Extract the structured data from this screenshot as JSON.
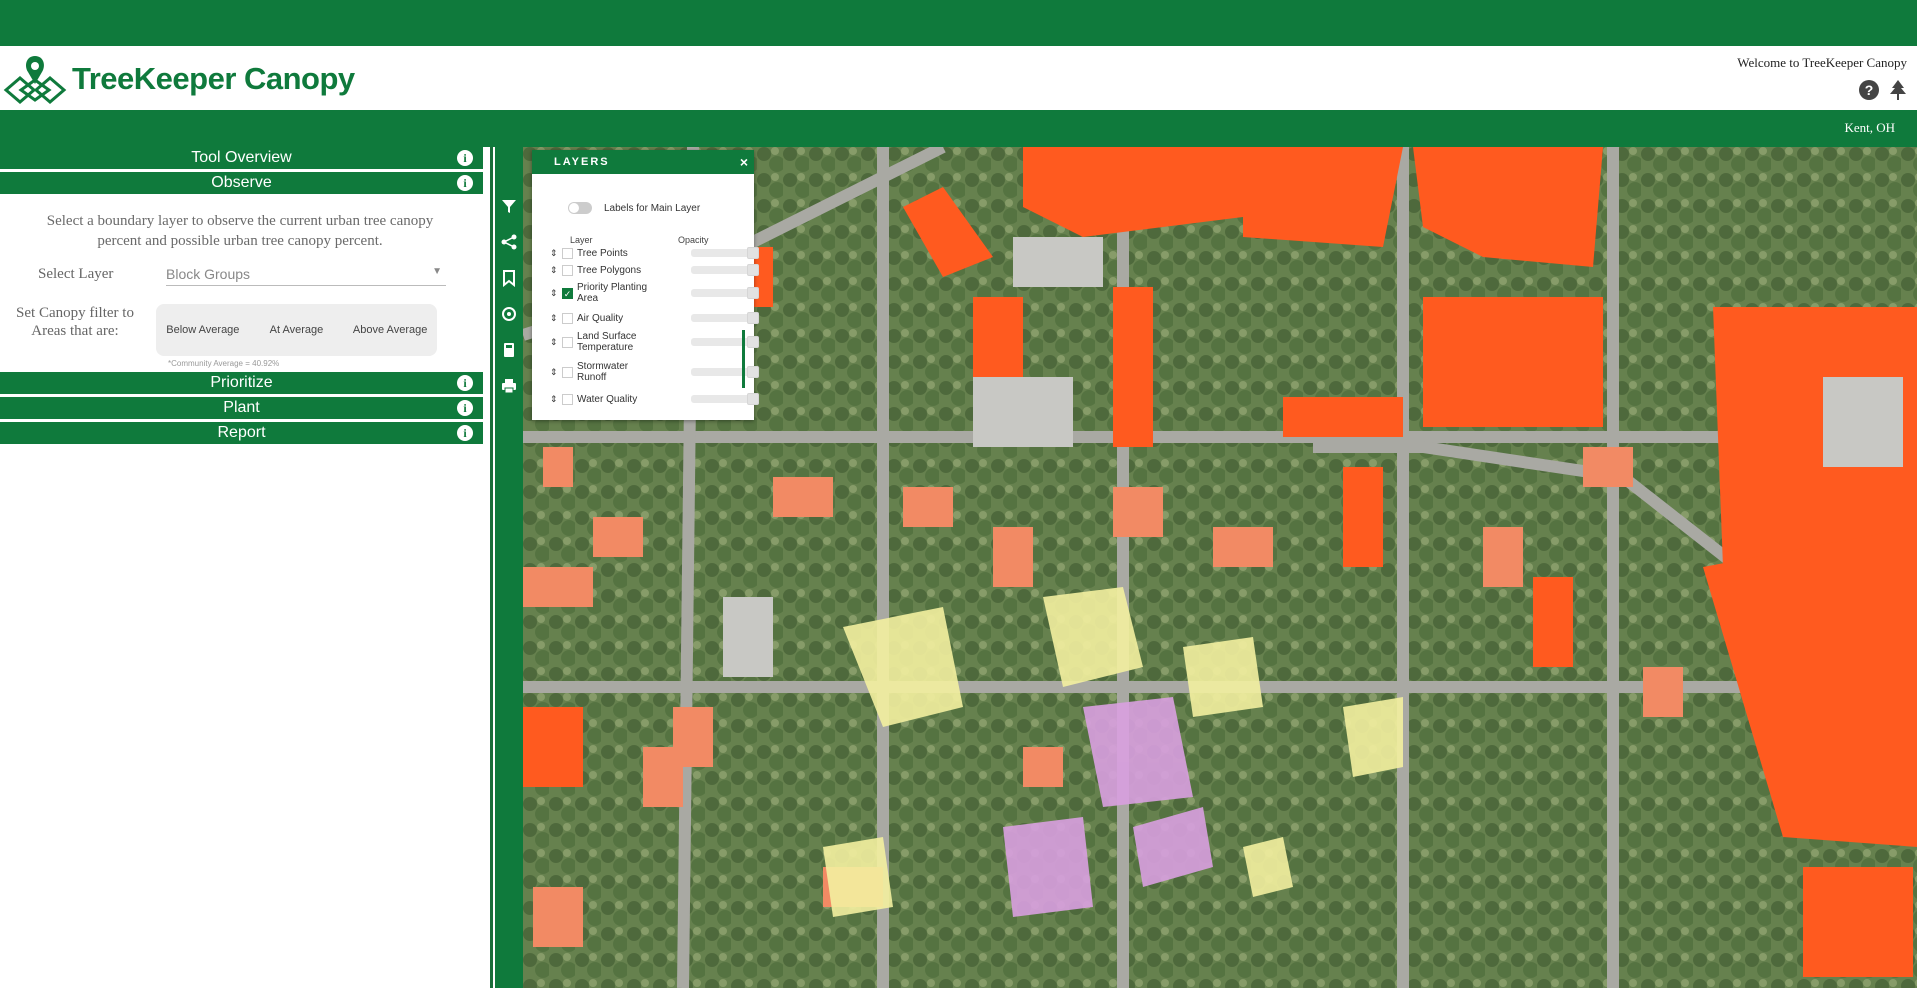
{
  "header": {
    "app_name": "TreeKeeper Canopy",
    "welcome": "Welcome to TreeKeeper Canopy",
    "help_icon": "?",
    "location": "Kent, OH",
    "brand_color": "#0f7a3c"
  },
  "sidebar": {
    "sections": {
      "tool_overview": "Tool Overview",
      "observe": "Observe",
      "prioritize": "Prioritize",
      "plant": "Plant",
      "report": "Report"
    },
    "info_icon": "i",
    "observe": {
      "description": "Select a boundary layer to observe the current urban tree canopy percent and possible urban tree canopy percent.",
      "select_label": "Select Layer",
      "select_value": "Block Groups",
      "filter_label": "Set Canopy filter to Areas that are:",
      "filters": [
        "Below Average",
        "At Average",
        "Above Average"
      ],
      "community_average": "*Community Average = 40.92%"
    }
  },
  "toolbar": {
    "icons": [
      "filter-icon",
      "share-icon",
      "bookmark-icon",
      "target-icon",
      "calculator-icon",
      "print-icon"
    ]
  },
  "layers_panel": {
    "title": "LAYERS",
    "close": "×",
    "toggle_label": "Labels for Main Layer",
    "column_layer": "Layer",
    "column_opacity": "Opacity",
    "layers": [
      {
        "name": "Tree Points",
        "checked": false
      },
      {
        "name": "Tree Polygons",
        "checked": false
      },
      {
        "name": "Priority Planting Area",
        "checked": true
      },
      {
        "name": "Air Quality",
        "checked": false
      },
      {
        "name": "Land Surface Temperature",
        "checked": false
      },
      {
        "name": "Stormwater Runoff",
        "checked": false
      },
      {
        "name": "Water Quality",
        "checked": false
      }
    ]
  },
  "map": {
    "overlay_colors": {
      "priority_high": "#ff5a1f",
      "priority_medium": "#f28a64",
      "priority_low": "#f3f0a0",
      "priority_other": "#d9a0e0"
    }
  }
}
